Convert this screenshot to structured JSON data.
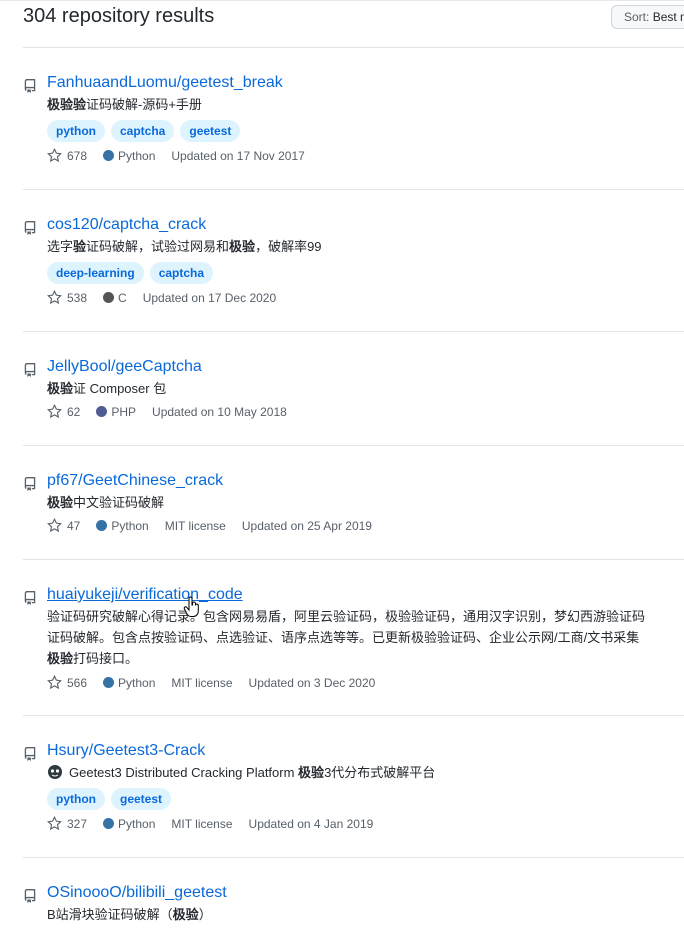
{
  "header": {
    "results_title": "304 repository results"
  },
  "sort": {
    "label": "Sort:",
    "value": "Best match"
  },
  "colors": {
    "python": "#3572A5",
    "c": "#555555",
    "php": "#4F5D95",
    "link": "#0969da"
  },
  "repos": [
    {
      "title": "FanhuaandLuomu/geetest_break",
      "desc_bold": "极验验",
      "desc_rest": "证码破解-源码+手册",
      "topics": [
        "python",
        "captcha",
        "geetest"
      ],
      "stars": "678",
      "language": "Python",
      "updated": "Updated on 17 Nov 2017"
    },
    {
      "title": "cos120/captcha_crack",
      "desc_a": "选字",
      "desc_b": "验",
      "desc_c": "证码破解，试验过网易和",
      "desc_d": "极验",
      "desc_e": "，破解率99",
      "topics": [
        "deep-learning",
        "captcha"
      ],
      "stars": "538",
      "language": "C",
      "updated": "Updated on 17 Dec 2020"
    },
    {
      "title": "JellyBool/geeCaptcha",
      "desc_bold": "极验",
      "desc_rest": "证 Composer 包",
      "stars": "62",
      "language": "PHP",
      "updated": "Updated on 10 May 2018"
    },
    {
      "title": "pf67/GeetChinese_crack",
      "desc_bold": "极验",
      "desc_rest": "中文验证码破解",
      "stars": "47",
      "language": "Python",
      "license": "MIT license",
      "updated": "Updated on 25 Apr 2019"
    },
    {
      "title": "huaiyukeji/verification_code",
      "desc_line1": "验证码研究破解心得记录。包含网易易盾，阿里云验证码，极验验证码，通用汉字识别，梦幻西游验证码",
      "desc_line2": "证码破解。包含点按验证码、点选验证、语序点选等等。已更新极验验证码、企业公示网/工商/文书采集",
      "desc_line3_bold": "极验",
      "desc_line3_rest": "打码接口。",
      "stars": "566",
      "language": "Python",
      "license": "MIT license",
      "updated": "Updated on 3 Dec 2020"
    },
    {
      "title": "Hsury/Geetest3-Crack",
      "desc_a": "Geetest3 Distributed Cracking Platform ",
      "desc_bold": "极验",
      "desc_rest": "3代分布式破解平台",
      "topics": [
        "python",
        "geetest"
      ],
      "stars": "327",
      "language": "Python",
      "license": "MIT license",
      "updated": "Updated on 4 Jan 2019"
    },
    {
      "title": "OSinoooO/bilibili_geetest",
      "desc_a": "B站滑块验证码破解（",
      "desc_bold": "极验",
      "desc_rest": "）"
    }
  ]
}
